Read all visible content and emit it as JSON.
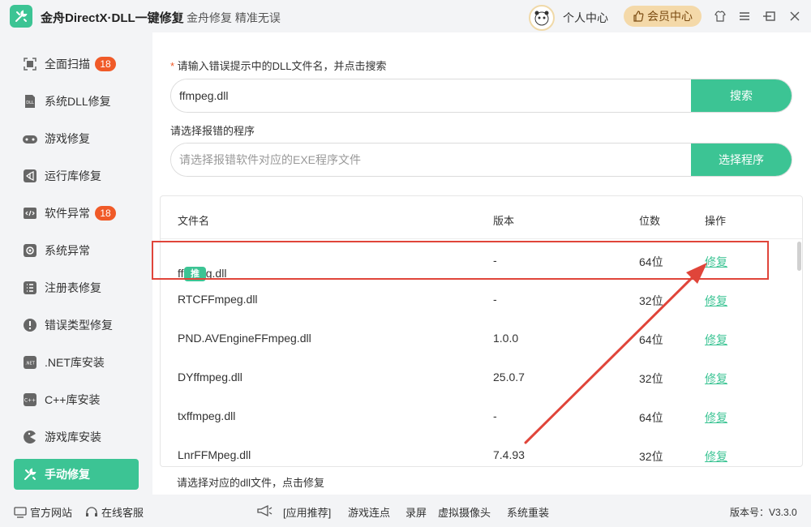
{
  "app": {
    "title": "金舟DirectX·DLL一键修复",
    "slogan": "金舟修复 精准无误",
    "personal_center": "个人中心",
    "vip_center": "会员中心"
  },
  "sidebar": {
    "items": [
      {
        "label": "全面扫描",
        "badge": "18",
        "icon": "scan-icon"
      },
      {
        "label": "系统DLL修复",
        "icon": "dll-icon"
      },
      {
        "label": "游戏修复",
        "icon": "gamepad-icon"
      },
      {
        "label": "运行库修复",
        "icon": "vs-icon"
      },
      {
        "label": "软件异常",
        "badge": "18",
        "icon": "code-icon"
      },
      {
        "label": "系统异常",
        "icon": "gear-icon"
      },
      {
        "label": "注册表修复",
        "icon": "list-icon"
      },
      {
        "label": "错误类型修复",
        "icon": "warning-icon"
      },
      {
        "label": ".NET库安装",
        "icon": "dotnet-icon"
      },
      {
        "label": "C++库安装",
        "icon": "cpp-icon"
      },
      {
        "label": "游戏库安装",
        "icon": "pacman-icon"
      },
      {
        "label": "手动修复",
        "icon": "wrench-icon",
        "active": true
      }
    ]
  },
  "search": {
    "label": "请输入错误提示中的DLL文件名，并点击搜索",
    "value": "ffmpeg.dll",
    "button": "搜索"
  },
  "program": {
    "label": "请选择报错的程序",
    "placeholder": "请选择报错软件对应的EXE程序文件",
    "button": "选择程序"
  },
  "table": {
    "headers": {
      "name": "文件名",
      "version": "版本",
      "bits": "位数",
      "action": "操作"
    },
    "rows": [
      {
        "name": "ffmpeg.dll",
        "tag": "推荐",
        "version": "-",
        "bits": "64位",
        "action": "修复"
      },
      {
        "name": "RTCFFmpeg.dll",
        "version": "-",
        "bits": "32位",
        "action": "修复"
      },
      {
        "name": "PND.AVEngineFFmpeg.dll",
        "version": "1.0.0",
        "bits": "64位",
        "action": "修复"
      },
      {
        "name": "DYffmpeg.dll",
        "version": "25.0.7",
        "bits": "32位",
        "action": "修复"
      },
      {
        "name": "txffmpeg.dll",
        "version": "-",
        "bits": "64位",
        "action": "修复"
      },
      {
        "name": "LnrFFMpeg.dll",
        "version": "7.4.93",
        "bits": "32位",
        "action": "修复"
      }
    ],
    "hint": "请选择对应的dll文件，点击修复"
  },
  "footer": {
    "official_site": "官方网站",
    "online_service": "在线客服",
    "app_recommend": "[应用推荐]",
    "links": [
      "游戏连点",
      "录屏",
      "虚拟摄像头",
      "系统重装"
    ],
    "version": "版本号：V3.3.0"
  },
  "colors": {
    "accent": "#3cc494",
    "badge": "#f05a28",
    "highlight": "#e0453a",
    "vip_bg": "#f4d9a9"
  }
}
